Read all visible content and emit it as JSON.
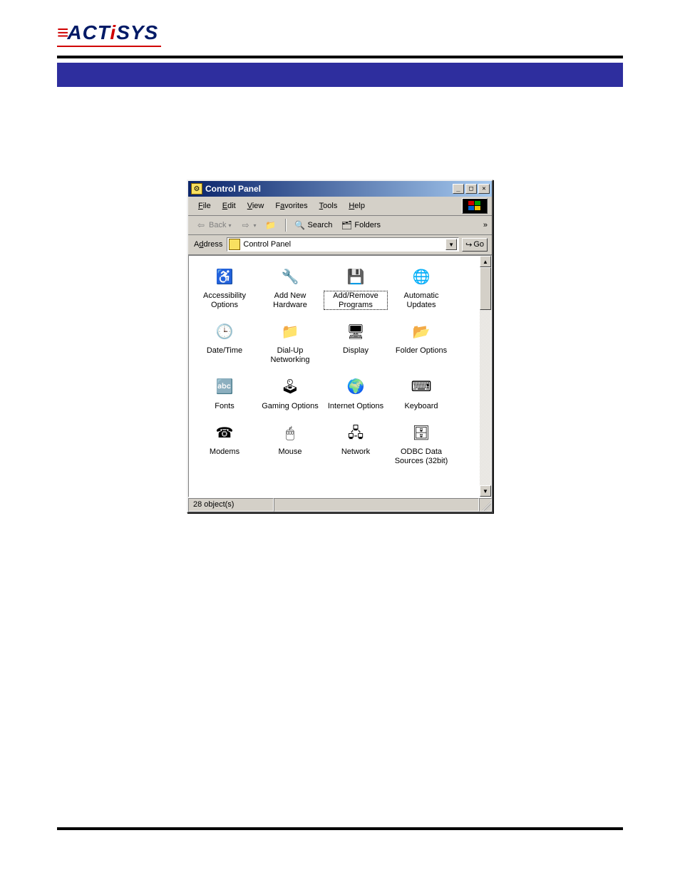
{
  "logo": {
    "text": "ACTiSYS"
  },
  "window": {
    "title": "Control Panel",
    "menus": [
      "File",
      "Edit",
      "View",
      "Favorites",
      "Tools",
      "Help"
    ],
    "toolbar": {
      "back": "Back",
      "search": "Search",
      "folders": "Folders"
    },
    "address": {
      "label": "Address",
      "value": "Control Panel",
      "go": "Go"
    },
    "icons": [
      {
        "label": "Accessibility Options",
        "glyph": "♿",
        "bg": "#ffffff",
        "selected": false
      },
      {
        "label": "Add New Hardware",
        "glyph": "🔧",
        "bg": "",
        "selected": false
      },
      {
        "label": "Add/Remove Programs",
        "glyph": "💾",
        "bg": "",
        "selected": true
      },
      {
        "label": "Automatic Updates",
        "glyph": "🌐",
        "bg": "",
        "selected": false
      },
      {
        "label": "Date/Time",
        "glyph": "🕒",
        "bg": "",
        "selected": false
      },
      {
        "label": "Dial-Up Networking",
        "glyph": "📁",
        "bg": "",
        "selected": false
      },
      {
        "label": "Display",
        "glyph": "🖥",
        "bg": "",
        "selected": false
      },
      {
        "label": "Folder Options",
        "glyph": "📂",
        "bg": "",
        "selected": false
      },
      {
        "label": "Fonts",
        "glyph": "🔤",
        "bg": "",
        "selected": false
      },
      {
        "label": "Gaming Options",
        "glyph": "🕹",
        "bg": "",
        "selected": false
      },
      {
        "label": "Internet Options",
        "glyph": "🌍",
        "bg": "",
        "selected": false
      },
      {
        "label": "Keyboard",
        "glyph": "⌨",
        "bg": "",
        "selected": false
      },
      {
        "label": "Modems",
        "glyph": "☎",
        "bg": "",
        "selected": false
      },
      {
        "label": "Mouse",
        "glyph": "🖱",
        "bg": "",
        "selected": false
      },
      {
        "label": "Network",
        "glyph": "🖧",
        "bg": "",
        "selected": false
      },
      {
        "label": "ODBC Data Sources (32bit)",
        "glyph": "🗄",
        "bg": "",
        "selected": false
      }
    ],
    "status": "28 object(s)",
    "chevrons": "»"
  }
}
